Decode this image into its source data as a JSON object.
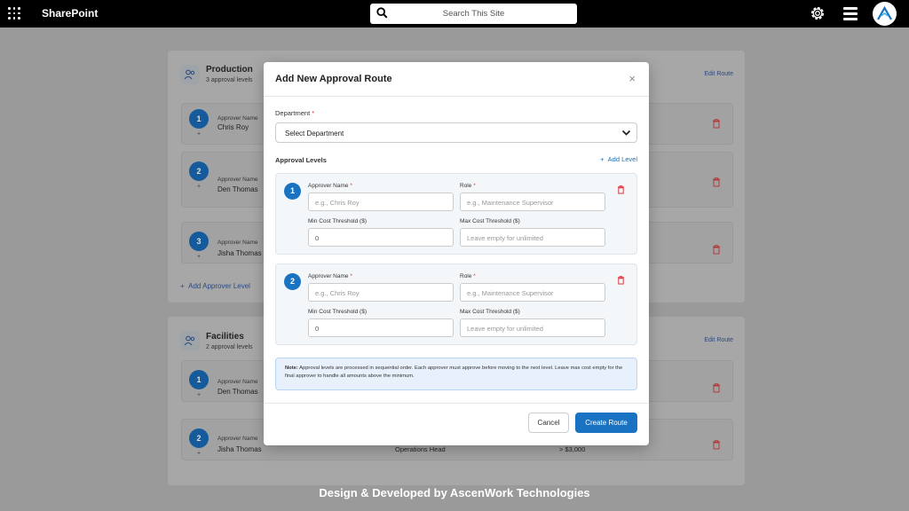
{
  "topbar": {
    "brand": "SharePoint",
    "search_placeholder": "Search This Site"
  },
  "background": {
    "departments": [
      {
        "name": "Production",
        "sub": "3 approval levels",
        "edit": "Edit Route",
        "levels": [
          {
            "num": "1",
            "label": "Approver Name",
            "name": "Chris Roy"
          },
          {
            "num": "2",
            "label": "Approver Name",
            "name": "Den Thomas"
          },
          {
            "num": "3",
            "label": "Approver Name",
            "name": "Jisha Thomas"
          }
        ],
        "add": "Add Approver Level"
      },
      {
        "name": "Facilities",
        "sub": "2 approval levels",
        "edit": "Edit Route",
        "levels": [
          {
            "num": "1",
            "label": "Approver Name",
            "name": "Den Thomas",
            "role": "",
            "cost": ""
          },
          {
            "num": "2",
            "label": "Approver Name",
            "name": "Jisha Thomas",
            "role": "Operations Head",
            "cost": "> $3,000"
          }
        ]
      }
    ]
  },
  "modal": {
    "title": "Add New Approval Route",
    "close": "×",
    "department_label": "Department",
    "required_mark": "*",
    "department_value": "Select Department",
    "section_label": "Approval Levels",
    "add_level": "Add Level",
    "levels": [
      {
        "num": "1",
        "approver_label": "Approver Name",
        "approver_placeholder": "e.g., Chris Roy",
        "role_label": "Role",
        "role_placeholder": "e.g., Maintenance Supervisor",
        "min_label": "Min Cost Threshold ($)",
        "min_value": "0",
        "max_label": "Max Cost Threshold ($)",
        "max_placeholder": "Leave empty for unlimited"
      },
      {
        "num": "2",
        "approver_label": "Approver Name",
        "approver_placeholder": "e.g., Chris Roy",
        "role_label": "Role",
        "role_placeholder": "e.g., Maintenance Supervisor",
        "min_label": "Min Cost Threshold ($)",
        "min_value": "0",
        "max_label": "Max Cost Threshold ($)",
        "max_placeholder": "Leave empty for unlimited"
      }
    ],
    "note_bold": "Note:",
    "note_text": "Approval levels are processed in sequential order. Each approver must approve before moving to the next level. Leave max cost empty for the final approver to handle all amounts above the minimum.",
    "cancel": "Cancel",
    "create": "Create Route"
  },
  "footer": "Design & Developed by AscenWork Technologies",
  "colors": {
    "accent": "#1a73c2",
    "danger": "#d9363e"
  }
}
